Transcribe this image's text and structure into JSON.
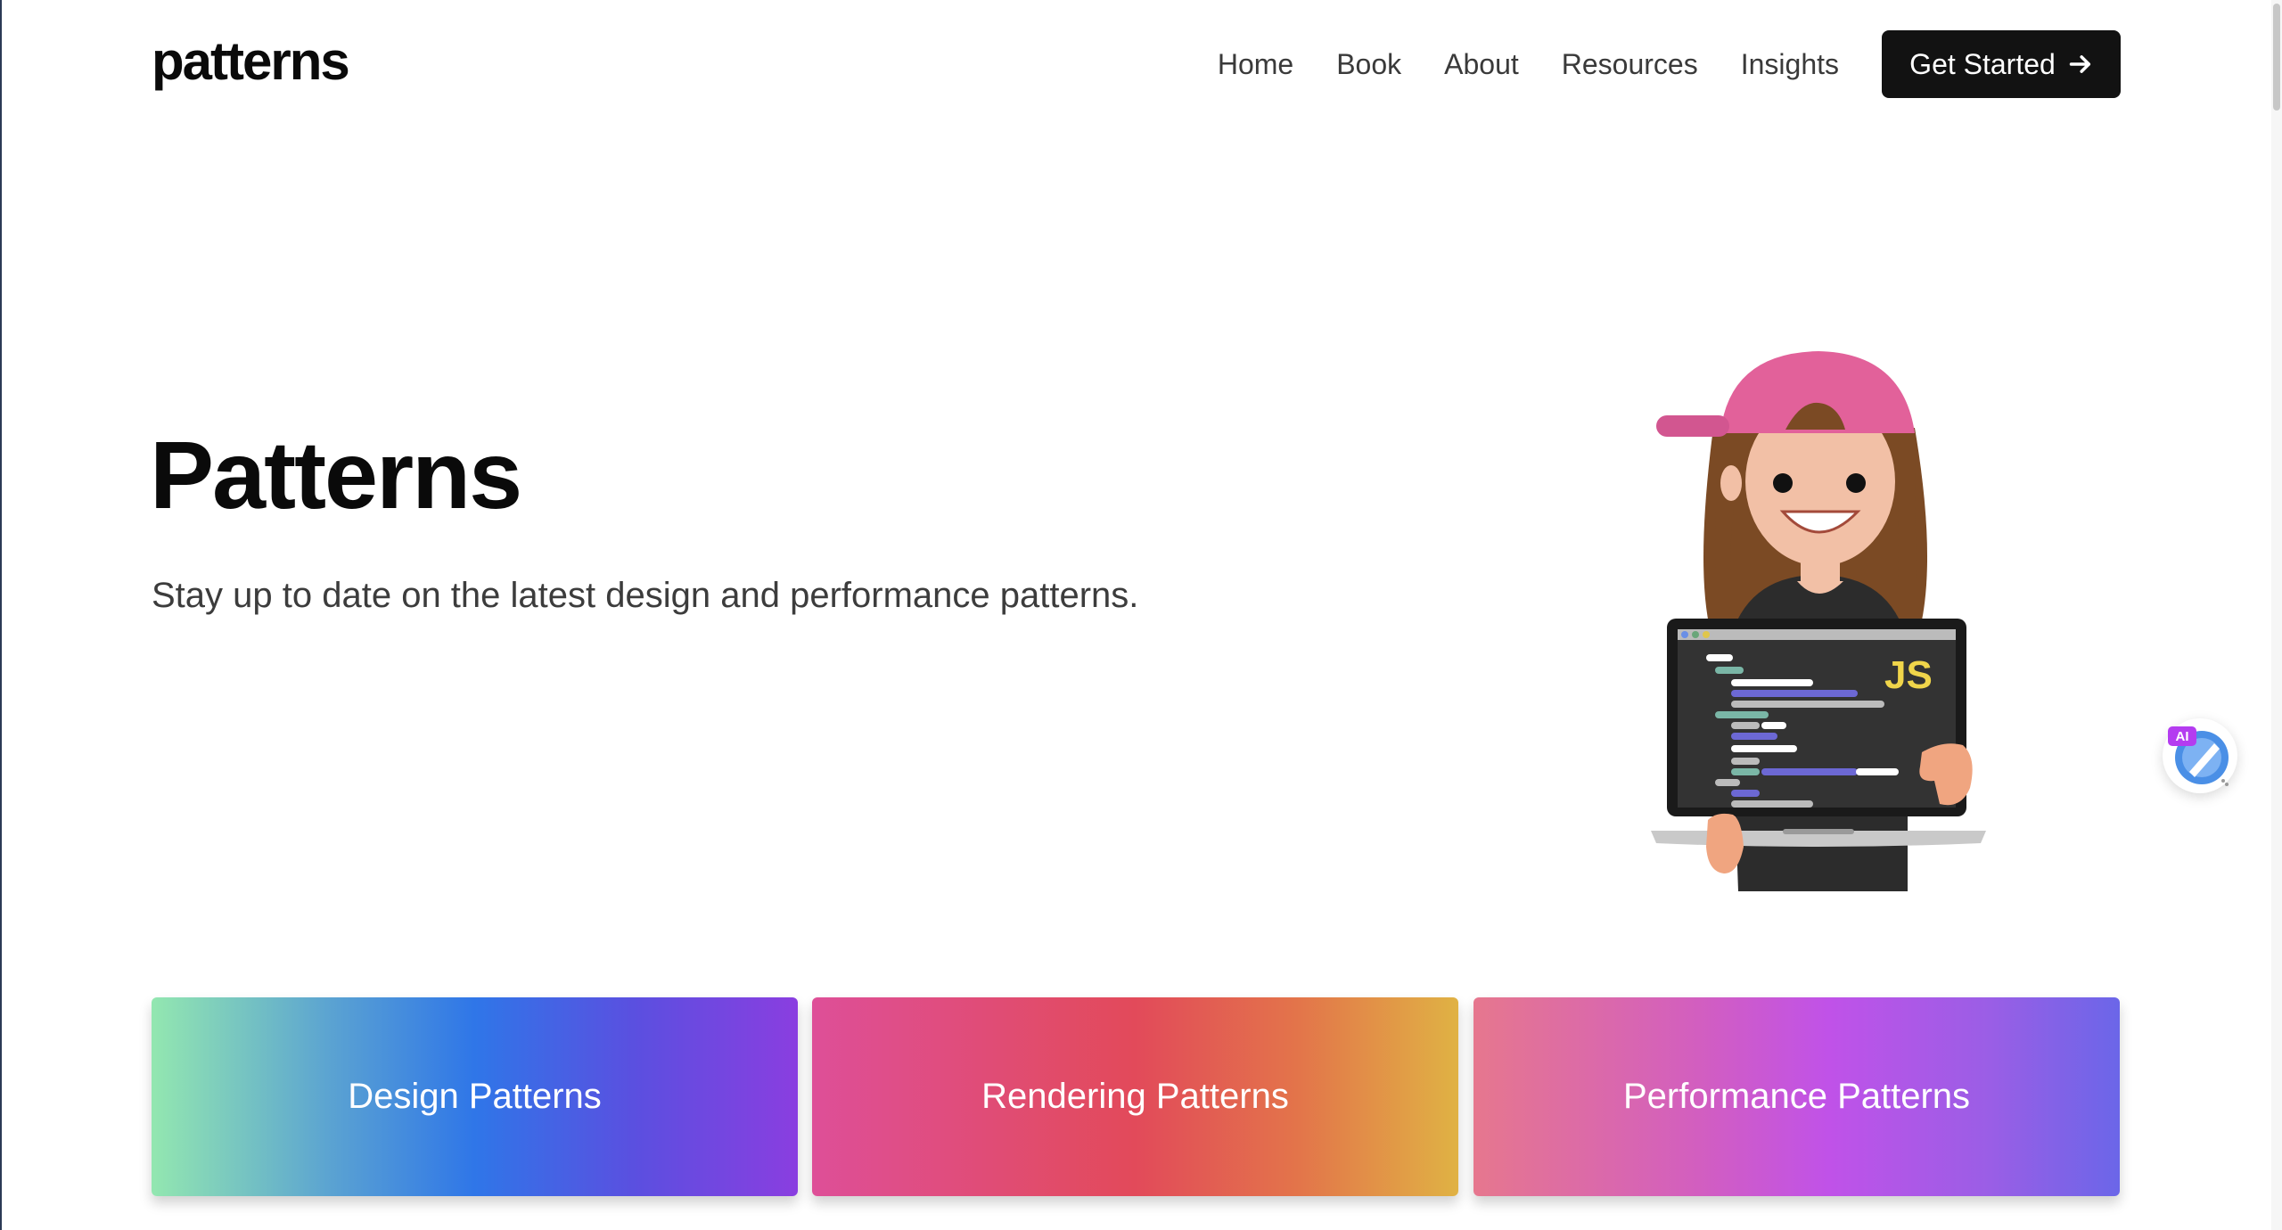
{
  "header": {
    "logo": "patterns",
    "nav": [
      "Home",
      "Book",
      "About",
      "Resources",
      "Insights"
    ],
    "cta_label": "Get Started",
    "cta_icon": "arrow-right-icon"
  },
  "hero": {
    "title": "Patterns",
    "subtitle": "Stay up to date on the latest design and performance patterns.",
    "illustration_badge": "JS"
  },
  "cards": [
    {
      "label": "Design Patterns"
    },
    {
      "label": "Rendering Patterns"
    },
    {
      "label": "Performance Patterns"
    }
  ],
  "widget": {
    "badge": "AI",
    "icon": "ai-assistant-icon"
  },
  "colors": {
    "cta_background": "#121212",
    "text_primary": "#0a0a0a",
    "cap_pink": "#e2619a",
    "js_yellow": "#f0d54a"
  }
}
